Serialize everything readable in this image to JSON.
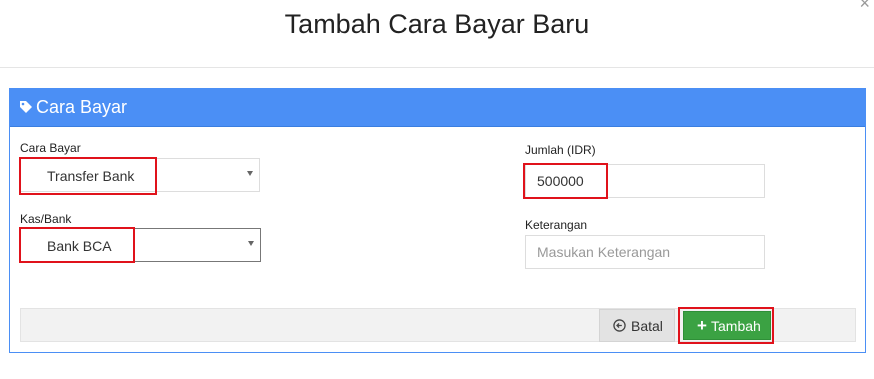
{
  "modal": {
    "title": "Tambah Cara Bayar Baru",
    "close_icon": "close-icon"
  },
  "panel": {
    "title": "Cara Bayar",
    "icon": "tag-icon",
    "header_color": "#4b8ff5"
  },
  "form": {
    "cara_bayar": {
      "label": "Cara Bayar",
      "value": "Transfer Bank"
    },
    "kas_bank": {
      "label": "Kas/Bank",
      "value": "Bank BCA"
    },
    "jumlah": {
      "label": "Jumlah (IDR)",
      "value": "500000"
    },
    "keterangan": {
      "label": "Keterangan",
      "value": "",
      "placeholder": "Masukan Keterangan"
    }
  },
  "buttons": {
    "batal": {
      "label": "Batal",
      "icon": "arrow-circle-left-icon"
    },
    "tambah": {
      "label": "Tambah",
      "icon": "plus-icon",
      "color": "#3ba243"
    }
  },
  "highlight_color": "#e0121b"
}
